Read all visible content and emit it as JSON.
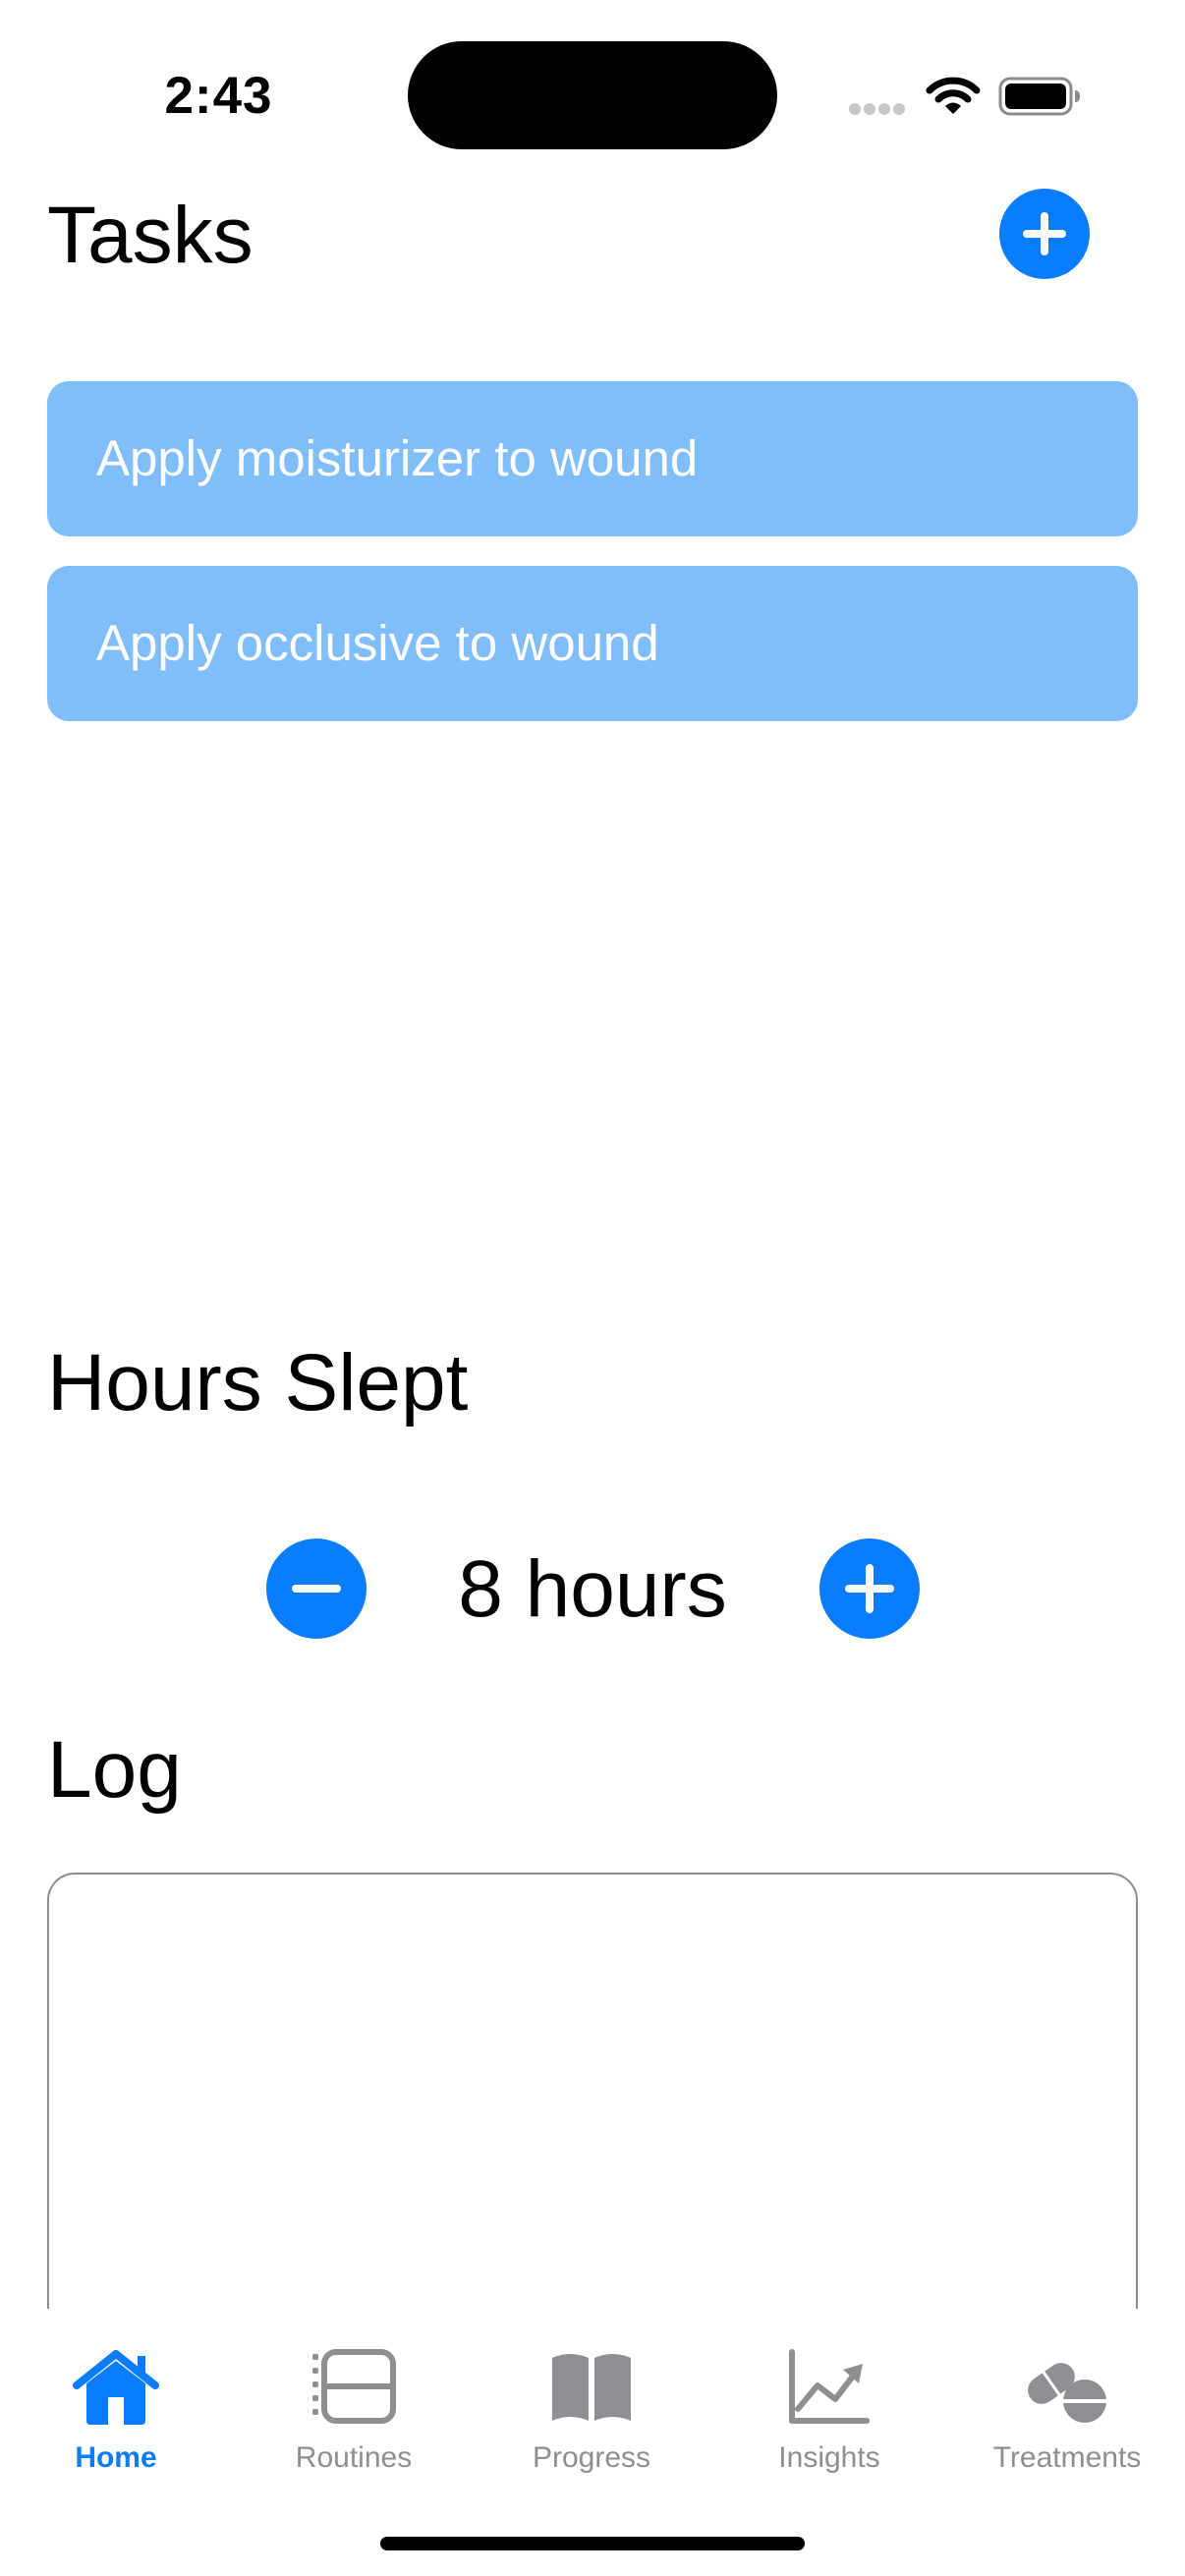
{
  "status_bar": {
    "time": "2:43",
    "icons": [
      "signal-dots-icon",
      "wifi-icon",
      "battery-icon"
    ]
  },
  "tasks": {
    "title": "Tasks",
    "add_icon": "plus-circle-icon",
    "items": [
      {
        "label": "Apply moisturizer to wound"
      },
      {
        "label": "Apply occlusive to wound"
      }
    ]
  },
  "hours_slept": {
    "title": "Hours Slept",
    "value": "8 hours",
    "decrement_icon": "minus-circle-icon",
    "increment_icon": "plus-circle-icon"
  },
  "log": {
    "title": "Log",
    "value": ""
  },
  "tab_bar": {
    "tabs": [
      {
        "label": "Home",
        "icon": "house-icon",
        "selected": true
      },
      {
        "label": "Routines",
        "icon": "list-icon",
        "selected": false
      },
      {
        "label": "Progress",
        "icon": "book-icon",
        "selected": false
      },
      {
        "label": "Insights",
        "icon": "chart-icon",
        "selected": false
      },
      {
        "label": "Treatments",
        "icon": "pills-icon",
        "selected": false
      }
    ]
  },
  "colors": {
    "accent": "#0A7CFF",
    "task_card": "#80BDFB",
    "tab_inactive": "#8E8E93",
    "text": "#000000"
  }
}
